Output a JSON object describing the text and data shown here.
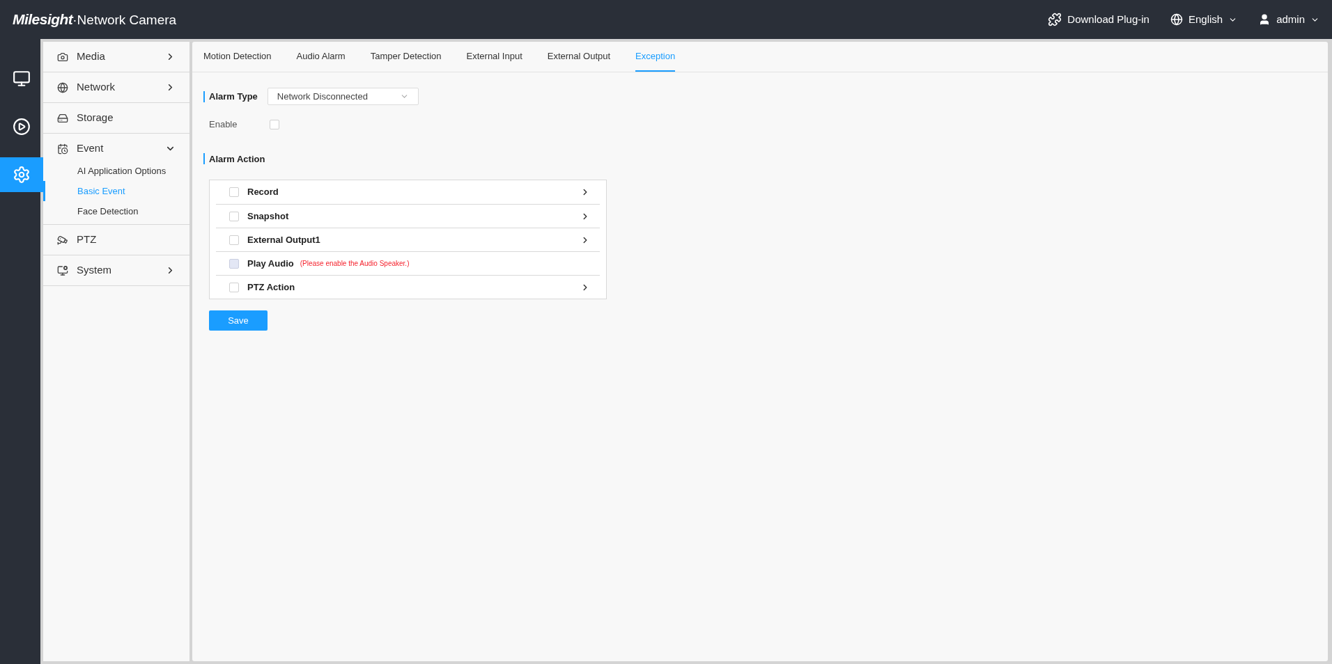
{
  "header": {
    "brand": "Milesight",
    "product": "·Network Camera",
    "download": "Download Plug-in",
    "language": "English",
    "user": "admin"
  },
  "rail": [
    {
      "kind": "live",
      "selected": false
    },
    {
      "kind": "playback",
      "selected": false
    },
    {
      "kind": "settings",
      "selected": true
    }
  ],
  "sidebar": {
    "items": [
      {
        "label": "Media",
        "has_arrow": true,
        "expanded": false
      },
      {
        "label": "Network",
        "has_arrow": true,
        "expanded": false
      },
      {
        "label": "Storage",
        "has_arrow": false
      },
      {
        "label": "Event",
        "has_arrow": true,
        "expanded": true,
        "children": [
          {
            "label": "AI Application Options",
            "selected": false
          },
          {
            "label": "Basic Event",
            "selected": true
          },
          {
            "label": "Face Detection",
            "selected": false
          }
        ]
      },
      {
        "label": "PTZ",
        "has_arrow": false
      },
      {
        "label": "System",
        "has_arrow": true,
        "expanded": false
      }
    ]
  },
  "tabs": [
    {
      "label": "Motion Detection",
      "selected": false
    },
    {
      "label": "Audio Alarm",
      "selected": false
    },
    {
      "label": "Tamper Detection",
      "selected": false
    },
    {
      "label": "External Input",
      "selected": false
    },
    {
      "label": "External Output",
      "selected": false
    },
    {
      "label": "Exception",
      "selected": true
    }
  ],
  "alarm_type": {
    "label": "Alarm Type",
    "value": "Network Disconnected"
  },
  "enable": {
    "label": "Enable",
    "checked": false
  },
  "alarm_action": {
    "title": "Alarm Action",
    "rows": [
      {
        "label": "Record",
        "checked": false,
        "disabled": false,
        "has_arrow": true
      },
      {
        "label": "Snapshot",
        "checked": false,
        "disabled": false,
        "has_arrow": true
      },
      {
        "label": "External Output1",
        "checked": false,
        "disabled": false,
        "has_arrow": true
      },
      {
        "label": "Play Audio",
        "checked": false,
        "disabled": true,
        "note": "(Please enable the Audio Speaker.)",
        "has_arrow": false
      },
      {
        "label": "PTZ Action",
        "checked": false,
        "disabled": false,
        "has_arrow": true
      }
    ]
  },
  "save": "Save"
}
